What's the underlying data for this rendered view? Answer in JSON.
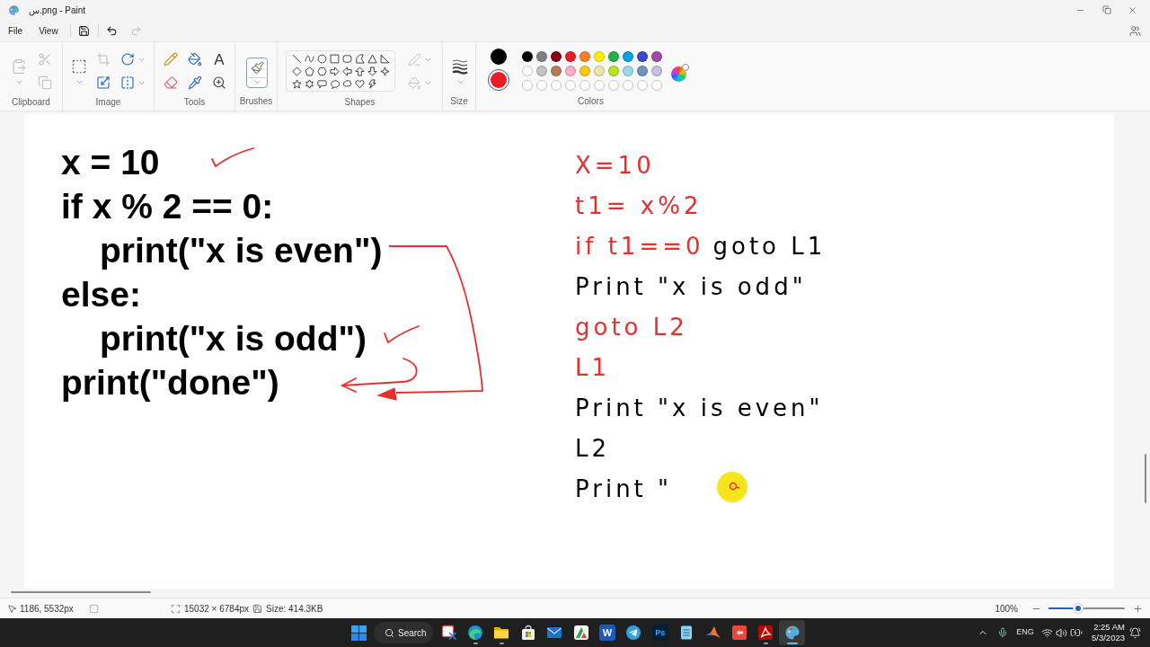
{
  "window": {
    "title": "س.png - Paint"
  },
  "menu": {
    "items": [
      "File",
      "View"
    ],
    "quick_actions": [
      {
        "kind": "save",
        "disabled": false
      },
      {
        "kind": "undo",
        "disabled": false
      },
      {
        "kind": "redo",
        "disabled": true
      }
    ]
  },
  "ribbon": {
    "clipboard": {
      "label": "Clipboard",
      "items": [
        {
          "kind": "paste",
          "disabled": true
        },
        {
          "kind": "cut",
          "disabled": true
        },
        {
          "kind": "copy",
          "disabled": true
        }
      ]
    },
    "image": {
      "label": "Image",
      "items": [
        {
          "kind": "select",
          "disabled": false
        },
        {
          "kind": "crop",
          "disabled": true
        },
        {
          "kind": "resize",
          "disabled": false
        },
        {
          "kind": "rotate",
          "disabled": false
        },
        {
          "kind": "flip",
          "disabled": false
        }
      ]
    },
    "tools": {
      "label": "Tools",
      "items": [
        {
          "kind": "pencil",
          "selected": false
        },
        {
          "kind": "fill",
          "selected": false
        },
        {
          "kind": "text",
          "glyph": "A",
          "selected": false
        },
        {
          "kind": "eraser",
          "selected": false
        },
        {
          "kind": "picker",
          "selected": false
        },
        {
          "kind": "magnifier",
          "selected": false
        }
      ]
    },
    "brushes": {
      "label": "Brushes",
      "selected": true
    },
    "shapes": {
      "label": "Shapes",
      "options": [
        {
          "kind": "outline",
          "disabled": true
        },
        {
          "kind": "fill",
          "disabled": true
        }
      ]
    },
    "size": {
      "label": "Size"
    },
    "colors": {
      "label": "Colors",
      "current": [
        {
          "color": "#000000",
          "selected": false
        },
        {
          "color": "#ed1c24",
          "selected": true
        }
      ],
      "palette": [
        {
          "kind": "filled",
          "color": "#000000"
        },
        {
          "kind": "filled",
          "color": "#7f7f7f"
        },
        {
          "kind": "filled",
          "color": "#880015"
        },
        {
          "kind": "filled",
          "color": "#ed1c24"
        },
        {
          "kind": "filled",
          "color": "#ff7f27"
        },
        {
          "kind": "filled",
          "color": "#fff200"
        },
        {
          "kind": "filled",
          "color": "#22b14c"
        },
        {
          "kind": "filled",
          "color": "#00a2e8"
        },
        {
          "kind": "filled",
          "color": "#3f48cc"
        },
        {
          "kind": "filled",
          "color": "#a349a4"
        },
        {
          "kind": "filled",
          "color": "#ffffff"
        },
        {
          "kind": "filled",
          "color": "#c3c3c3"
        },
        {
          "kind": "filled",
          "color": "#b97a57"
        },
        {
          "kind": "filled",
          "color": "#ffaec9"
        },
        {
          "kind": "filled",
          "color": "#ffc90e"
        },
        {
          "kind": "filled",
          "color": "#efe4b0"
        },
        {
          "kind": "filled",
          "color": "#b5e61d"
        },
        {
          "kind": "filled",
          "color": "#99d9ea"
        },
        {
          "kind": "filled",
          "color": "#7092be"
        },
        {
          "kind": "filled",
          "color": "#c8bfe7"
        },
        {
          "kind": "empty"
        },
        {
          "kind": "empty"
        },
        {
          "kind": "empty"
        },
        {
          "kind": "empty"
        },
        {
          "kind": "empty"
        },
        {
          "kind": "empty"
        },
        {
          "kind": "empty"
        },
        {
          "kind": "empty"
        },
        {
          "kind": "empty"
        },
        {
          "kind": "empty"
        }
      ]
    }
  },
  "canvas": {
    "code_lines": [
      {
        "text": "x = 10"
      },
      {
        "text": "if x % 2 == 0:",
        "children": [
          {
            "text": "print(\"x is even\")"
          }
        ]
      },
      {
        "text": "else:",
        "children": [
          {
            "text": "print(\"x is odd\")"
          }
        ]
      },
      {
        "text": "print(\"done\")"
      }
    ],
    "handwriting": [
      {
        "segments": [
          {
            "text": "X=10",
            "color": "#e53030"
          }
        ]
      },
      {
        "segments": [
          {
            "text": "t1= x%2",
            "color": "#e53030"
          }
        ]
      },
      {
        "segments": [
          {
            "text": "if t1==0",
            "color": "#e53030"
          },
          {
            "text": "goto L1",
            "color": "#000000"
          }
        ]
      },
      {
        "segments": [
          {
            "text": "Print \"x is odd\"",
            "color": "#000000"
          }
        ]
      },
      {
        "segments": [
          {
            "text": "goto L2",
            "color": "#e53030"
          }
        ]
      },
      {
        "segments": [
          {
            "text": "L1",
            "color": "#e53030"
          }
        ]
      },
      {
        "segments": [
          {
            "text": "Print \"x is even\"",
            "color": "#000000"
          }
        ]
      },
      {
        "segments": [
          {
            "text": "L2",
            "color": "#000000"
          }
        ]
      },
      {
        "segments": [
          {
            "text": "Print \"",
            "color": "#000000"
          }
        ]
      }
    ]
  },
  "status_bar": {
    "cursor_position": "1186, 5532px",
    "canvas_size": "15032 × 6784px",
    "file_size": "Size: 414.3KB",
    "zoom": {
      "reading": "100%",
      "level": 0.39
    }
  },
  "taskbar": {
    "search": "Search",
    "apps": [
      {
        "kind": "snip",
        "running": false,
        "selected": false
      },
      {
        "kind": "browser",
        "running": true,
        "selected": false
      },
      {
        "kind": "folder",
        "running": true,
        "selected": false
      },
      {
        "kind": "store",
        "running": false,
        "selected": false
      },
      {
        "kind": "mail",
        "running": false,
        "selected": false
      },
      {
        "kind": "triangle",
        "running": false,
        "selected": false
      },
      {
        "kind": "doc_tile",
        "label": "W",
        "running": false,
        "selected": false
      },
      {
        "kind": "plane",
        "running": false,
        "selected": false
      },
      {
        "kind": "photo_tile",
        "label": "Ps",
        "running": false,
        "selected": false
      },
      {
        "kind": "notepad",
        "running": false,
        "selected": false
      },
      {
        "kind": "peak",
        "running": false,
        "selected": false
      },
      {
        "kind": "diamonds",
        "running": false,
        "selected": false
      },
      {
        "kind": "pdf",
        "running": true,
        "selected": false
      },
      {
        "kind": "palette",
        "running": true,
        "selected": true
      }
    ],
    "tray": {
      "language": "ENG",
      "time": "2:25 AM",
      "date": "5/3/2023"
    }
  }
}
